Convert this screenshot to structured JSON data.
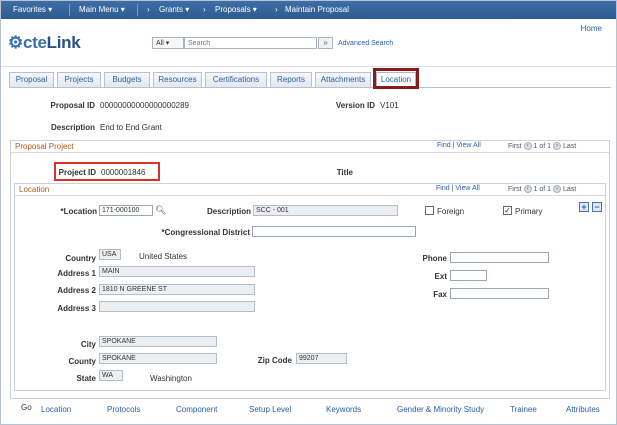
{
  "nav": {
    "favorites": "Favorites ▾",
    "main_menu": "Main Menu ▾",
    "crumb_grants": "Grants ▾",
    "crumb_proposals": "Proposals ▾",
    "crumb_maintain": "Maintain Proposal",
    "separator": "›"
  },
  "header": {
    "logo_a": "⚙cte",
    "logo_b": "Link",
    "home": "Home",
    "search_scope": "All ▾",
    "search_placeholder": "Search",
    "search_go": "»",
    "advanced_search": "Advanced Search"
  },
  "tabs": [
    "Proposal",
    "Projects",
    "Budgets",
    "Resources",
    "Certifications",
    "Reports",
    "Attachments",
    "Location"
  ],
  "proposal": {
    "proposal_id_label": "Proposal ID",
    "proposal_id": "00000000000000000289",
    "version_id_label": "Version ID",
    "version_id": "V101",
    "description_label": "Description",
    "description": "End to End Grant"
  },
  "proposal_project": {
    "title": "Proposal Project",
    "find": "Find",
    "view_all": "View All",
    "first": "First",
    "counter": "1 of 1",
    "last": "Last",
    "project_id_label": "Project ID",
    "project_id": "0000001846",
    "title_label": "Title"
  },
  "location": {
    "title": "Location",
    "find": "Find",
    "view_all": "View All",
    "first": "First",
    "counter": "1 of 1",
    "last": "Last",
    "location_label": "*Location",
    "location_value": "171-000100",
    "description_label": "Description",
    "description_value": "SCC - 001",
    "foreign_label": "Foreign",
    "primary_label": "Primary",
    "congressional_label": "*Congressional District",
    "country_label": "Country",
    "country_value": "USA",
    "country_name": "United States",
    "address1_label": "Address 1",
    "address1_value": "MAIN",
    "address2_label": "Address 2",
    "address2_value": "1810 N GREENE ST",
    "address3_label": "Address 3",
    "phone_label": "Phone",
    "ext_label": "Ext",
    "fax_label": "Fax",
    "city_label": "City",
    "city_value": "SPOKANE",
    "county_label": "County",
    "county_value": "SPOKANE",
    "zip_label": "Zip Code",
    "zip_value": "99207",
    "state_label": "State",
    "state_value": "WA",
    "state_name": "Washington",
    "add_row": "+",
    "delete_row": "−",
    "primary_checked": "✓"
  },
  "bottom_links": {
    "go": "Go",
    "items": [
      "Location",
      "Protocols",
      "Component",
      "Setup Level",
      "Keywords",
      "Gender & Minority Study",
      "Trainee",
      "Attributes"
    ]
  }
}
